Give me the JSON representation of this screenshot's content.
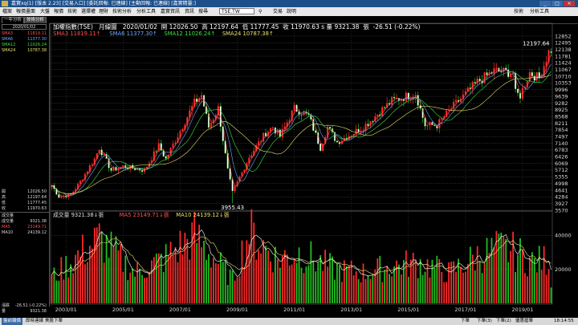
{
  "window": {
    "title": "嘉實xq(1) [版本 2.23] [交易入口] [委託回報: 已連線] [主動回報: 已連線] [嘉實精靈:]",
    "controls": [
      "_",
      "□",
      "×"
    ]
  },
  "menu": {
    "items": [
      "檔案",
      "報價畫面",
      "大盤",
      "報價",
      "技術",
      "選擇權",
      "理財",
      "技術分析",
      "分析工具",
      "嘉實資訊",
      "資訊",
      "搜尋",
      "交易",
      "說明"
    ],
    "symbol_value": "TSE.TW",
    "right_items": [
      "技術",
      "分析工具"
    ]
  },
  "tabs": [
    "一年分析",
    "技術分析"
  ],
  "side_panel": {
    "date": "2020/01/02",
    "ma_rows": [
      {
        "label": "SMA3",
        "value": "11819.11"
      },
      {
        "label": "SMA6",
        "value": "11377.30"
      },
      {
        "label": "SMA12",
        "value": "11026.24"
      },
      {
        "label": "SMA24",
        "value": "10787.38"
      }
    ],
    "ohlc_rows": [
      {
        "label": "開",
        "value": "12026.50"
      },
      {
        "label": "高",
        "value": "12197.64"
      },
      {
        "label": "低",
        "value": "11777.45"
      },
      {
        "label": "收",
        "value": "11970.63"
      }
    ],
    "vol_header": "成交量",
    "vol_rows": [
      {
        "label": "成交量",
        "value": "9321.38"
      },
      {
        "label": "MA5",
        "value": "23149.71"
      },
      {
        "label": "MA10",
        "value": "24139.12"
      }
    ],
    "change_rows": [
      {
        "label": "漲跌",
        "value": "-26.51 (-0.22%)"
      },
      {
        "label": "量",
        "value": "9321.38"
      }
    ]
  },
  "header": {
    "name": "加權指數(TSE)",
    "period": "月線圖",
    "date": "2020/01/02",
    "open_label": "開",
    "open": "12026.50",
    "high_label": "高",
    "high": "12197.64",
    "low_label": "低",
    "low": "11777.45",
    "close_label": "收",
    "close": "11970.63",
    "vol_label": "s 量",
    "vol": "9321.38",
    "change_label": "張",
    "change": "-26.51 (-0.22%)"
  },
  "sma_legend": [
    {
      "label": "SMA3",
      "value": "11819.11",
      "color": "#ff5050"
    },
    {
      "label": "SMA6",
      "value": "11377.30",
      "color": "#6fa8ff"
    },
    {
      "label": "SMA12",
      "value": "11026.24",
      "color": "#40e040"
    },
    {
      "label": "SMA24",
      "value": "10787.38",
      "color": "#e8e070"
    }
  ],
  "vol_legend": {
    "label": "成交量",
    "value": "9321.38",
    "ma5_label": "MA5",
    "ma5": "23149.71",
    "ma10_label": "MA10",
    "ma10": "24139.12"
  },
  "status_bar": {
    "items": [
      "盤前報價",
      "即時連線",
      "美股下單"
    ],
    "right_items": [
      "下單",
      "下單(3)",
      "下單(2)",
      "優惠搶單"
    ],
    "time": "18:14:55"
  },
  "colors": {
    "up": "#ff2a2a",
    "down": "#22c022",
    "grid": "#4a4a4a",
    "background": "#000000",
    "sma3": "#ff5050",
    "sma6": "#6fa8ff",
    "sma12": "#40e040",
    "sma24": "#e8e070",
    "vol_ma5": "#ffffff",
    "vol_ma10": "#e8e070"
  },
  "chart_data": [
    {
      "type": "candlestick",
      "title": "加權指數(TSE) 月線圖",
      "y_ticks": [
        12852,
        12495,
        12138,
        11781,
        11424,
        11067,
        10710,
        10353,
        9996,
        9639,
        9282,
        8925,
        8568,
        8211,
        7854,
        7497,
        7140,
        6783,
        6426,
        6069,
        5712,
        5355,
        4998,
        4641,
        4284,
        3927,
        3570
      ],
      "ylim": [
        3570,
        12852
      ],
      "x_ticks": [
        "2003/01",
        "2005/01",
        "2007/01",
        "2009/01",
        "2011/01",
        "2013/01",
        "2015/01",
        "2017/01",
        "2019/01"
      ],
      "start": "2002/07",
      "end": "2020/01",
      "annotations": [
        {
          "label": "12197.64",
          "date": "2020/01",
          "value": 12197.64
        },
        {
          "label": "3955.43",
          "date": "2008/11",
          "value": 3955.43
        }
      ],
      "anchor_closes": [
        {
          "date": "2002/07",
          "close": 4900
        },
        {
          "date": "2002/10",
          "close": 4300
        },
        {
          "date": "2003/03",
          "close": 4400
        },
        {
          "date": "2003/06",
          "close": 4900
        },
        {
          "date": "2004/01",
          "close": 6300
        },
        {
          "date": "2004/03",
          "close": 6900
        },
        {
          "date": "2004/08",
          "close": 5700
        },
        {
          "date": "2005/01",
          "close": 5900
        },
        {
          "date": "2005/10",
          "close": 5700
        },
        {
          "date": "2006/04",
          "close": 7000
        },
        {
          "date": "2006/07",
          "close": 6300
        },
        {
          "date": "2007/01",
          "close": 7800
        },
        {
          "date": "2007/07",
          "close": 9300
        },
        {
          "date": "2007/10",
          "close": 9700
        },
        {
          "date": "2008/01",
          "close": 8000
        },
        {
          "date": "2008/05",
          "close": 9000
        },
        {
          "date": "2008/09",
          "close": 5700
        },
        {
          "date": "2008/11",
          "close": 4500
        },
        {
          "date": "2009/06",
          "close": 6400
        },
        {
          "date": "2010/01",
          "close": 7700
        },
        {
          "date": "2010/04",
          "close": 8000
        },
        {
          "date": "2010/07",
          "close": 7500
        },
        {
          "date": "2011/01",
          "close": 9000
        },
        {
          "date": "2011/07",
          "close": 8600
        },
        {
          "date": "2011/12",
          "close": 6900
        },
        {
          "date": "2012/03",
          "close": 8000
        },
        {
          "date": "2012/07",
          "close": 7200
        },
        {
          "date": "2013/06",
          "close": 8000
        },
        {
          "date": "2014/06",
          "close": 9400
        },
        {
          "date": "2015/04",
          "close": 9800
        },
        {
          "date": "2015/08",
          "close": 8100
        },
        {
          "date": "2016/01",
          "close": 8100
        },
        {
          "date": "2016/07",
          "close": 9000
        },
        {
          "date": "2017/06",
          "close": 10400
        },
        {
          "date": "2018/01",
          "close": 11000
        },
        {
          "date": "2018/09",
          "close": 10900
        },
        {
          "date": "2018/10",
          "close": 9800
        },
        {
          "date": "2018/12",
          "close": 9700
        },
        {
          "date": "2019/04",
          "close": 10900
        },
        {
          "date": "2019/08",
          "close": 10600
        },
        {
          "date": "2019/12",
          "close": 12000
        },
        {
          "date": "2020/01",
          "close": 11970.63
        }
      ]
    },
    {
      "type": "bar",
      "title": "成交量",
      "y_ticks": [
        40000,
        20000
      ],
      "ylim": [
        0,
        50000
      ],
      "latest": 9321.38,
      "ma5": 23149.71,
      "ma10": 24139.12,
      "anchor_volumes": [
        {
          "date": "2002/07",
          "volume": 15000
        },
        {
          "date": "2003/06",
          "volume": 28000
        },
        {
          "date": "2004/03",
          "volume": 38000
        },
        {
          "date": "2005/06",
          "volume": 18000
        },
        {
          "date": "2006/06",
          "volume": 26000
        },
        {
          "date": "2007/07",
          "volume": 40000
        },
        {
          "date": "2008/11",
          "volume": 14000
        },
        {
          "date": "2009/06",
          "volume": 42000
        },
        {
          "date": "2010/06",
          "volume": 26000
        },
        {
          "date": "2011/03",
          "volume": 30000
        },
        {
          "date": "2012/06",
          "volume": 20000
        },
        {
          "date": "2013/06",
          "volume": 18000
        },
        {
          "date": "2014/06",
          "volume": 22000
        },
        {
          "date": "2015/06",
          "volume": 24000
        },
        {
          "date": "2016/06",
          "volume": 18000
        },
        {
          "date": "2017/06",
          "volume": 28000
        },
        {
          "date": "2018/03",
          "volume": 32000
        },
        {
          "date": "2018/10",
          "volume": 30000
        },
        {
          "date": "2019/06",
          "volume": 24000
        },
        {
          "date": "2019/12",
          "volume": 26000
        },
        {
          "date": "2020/01",
          "volume": 9321.38
        }
      ]
    }
  ]
}
